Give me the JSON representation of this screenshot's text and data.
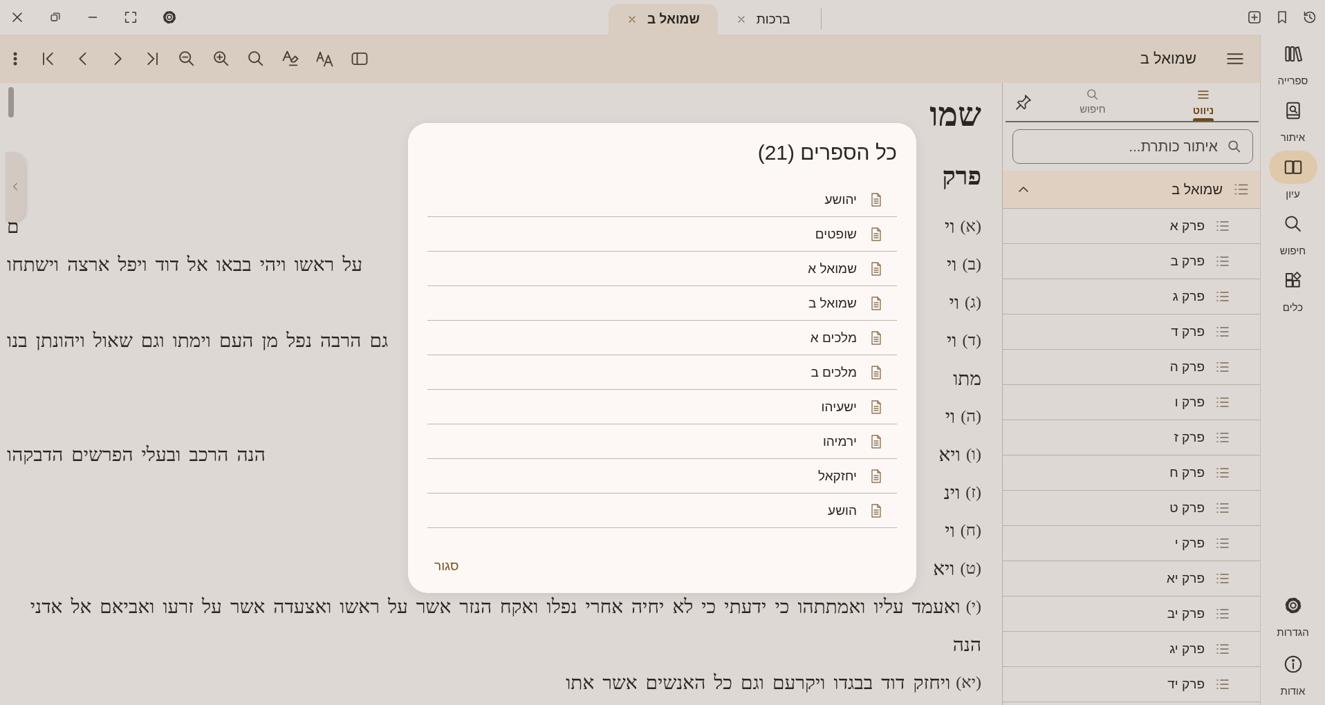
{
  "tabs": [
    {
      "label": "ברכות",
      "selected": false
    },
    {
      "label": "שמואל ב",
      "selected": true
    }
  ],
  "toolbar": {
    "title": "שמואל ב"
  },
  "document": {
    "title": "שמו",
    "heading": "פרק",
    "lines": [
      {
        "kind": "verse",
        "number": "(א)",
        "right": "וי",
        "left": "ם"
      },
      {
        "kind": "verse",
        "number": "(ב)",
        "right": "וי",
        "left": "על ראשו ויהי בבאו אל דוד ויפל ארצה וישתחו"
      },
      {
        "kind": "verse",
        "number": "(ג)",
        "right": "וי"
      },
      {
        "kind": "verse",
        "number": "(ד)",
        "right": "וי",
        "left": "גם הרבה נפל מן העם וימתו וגם שאול ויהונתן בנו"
      },
      {
        "kind": "continuation",
        "right": "מתו"
      },
      {
        "kind": "verse",
        "number": "(ה)",
        "right": "וי"
      },
      {
        "kind": "verse",
        "number": "(ו)",
        "right": "ויא",
        "left": "הנה הרכב ובעלי הפרשים הדבקהו"
      },
      {
        "kind": "verse",
        "number": "(ז)",
        "right": "וינ"
      },
      {
        "kind": "verse",
        "number": "(ח)",
        "right": "וי"
      },
      {
        "kind": "verse",
        "number": "(ט)",
        "right": "ויא"
      },
      {
        "kind": "verse",
        "number": "(י)",
        "right": "ואעמד עליו ואמתתהו כי ידעתי כי לא יחיה אחרי נפלו ואקח הנזר אשר על ראשו ואצעדה אשר על זרעו ואביאם אל אדני"
      },
      {
        "kind": "continuation",
        "right": "הנה"
      },
      {
        "kind": "verse",
        "number": "(יא)",
        "right": "ויחזק דוד בבגדו ויקרעם וגם כל האנשים אשר אתו"
      }
    ]
  },
  "navigation_panel": {
    "tabs": [
      {
        "kind": "outline",
        "label": "ניווט",
        "selected": true
      },
      {
        "kind": "search",
        "label": "חיפוש",
        "selected": false
      }
    ],
    "search": {
      "placeholder": "איתור כותרת..."
    },
    "tree": {
      "label": "שמואל ב",
      "expanded": true,
      "children": [
        {
          "label": "פרק א"
        },
        {
          "label": "פרק ב"
        },
        {
          "label": "פרק ג"
        },
        {
          "label": "פרק ד"
        },
        {
          "label": "פרק ה"
        },
        {
          "label": "פרק ו"
        },
        {
          "label": "פרק ז"
        },
        {
          "label": "פרק ח"
        },
        {
          "label": "פרק ט"
        },
        {
          "label": "פרק י"
        },
        {
          "label": "פרק יא"
        },
        {
          "label": "פרק יב"
        },
        {
          "label": "פרק יג"
        },
        {
          "label": "פרק יד"
        }
      ]
    }
  },
  "rail": {
    "items": [
      {
        "kind": "library",
        "label": "ספרייה",
        "selected": false
      },
      {
        "kind": "find",
        "label": "איתור",
        "selected": false
      },
      {
        "kind": "study",
        "label": "עיון",
        "selected": true
      },
      {
        "kind": "search",
        "label": "חיפוש",
        "selected": false
      },
      {
        "kind": "tools",
        "label": "כלים",
        "selected": false
      }
    ],
    "footer_items": [
      {
        "kind": "settings",
        "label": "הגדרות",
        "selected": false
      },
      {
        "kind": "about",
        "label": "אודות",
        "selected": false
      }
    ]
  },
  "dialog": {
    "title": "כל הספרים (21)",
    "items": [
      {
        "label": "יהושע"
      },
      {
        "label": "שופטים"
      },
      {
        "label": "שמואל א"
      },
      {
        "label": "שמואל ב"
      },
      {
        "label": "מלכים א"
      },
      {
        "label": "מלכים ב"
      },
      {
        "label": "ישעיהו"
      },
      {
        "label": "ירמיהו"
      },
      {
        "label": "יחזקאל"
      },
      {
        "label": "הושע"
      }
    ],
    "close_label": "סגור"
  }
}
